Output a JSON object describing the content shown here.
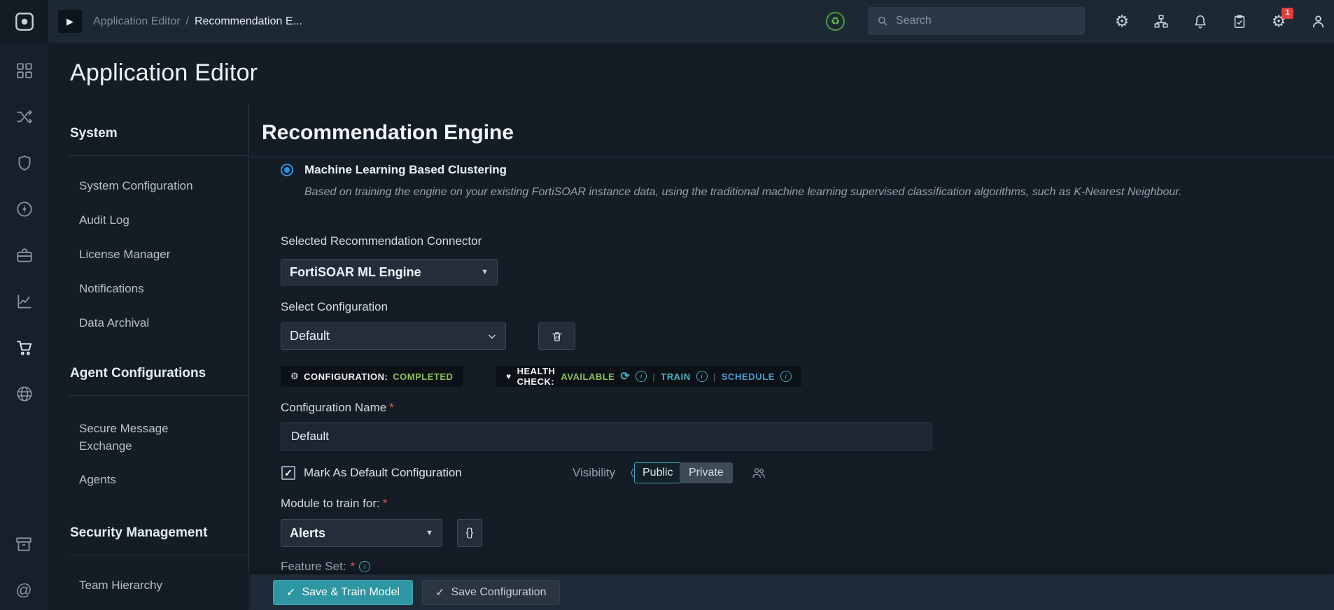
{
  "icons": {
    "play": "▶",
    "gear": "⚙",
    "recycle": "♻",
    "caret_down": "▼",
    "heart": "♥",
    "refresh": "⟳",
    "info": "i",
    "check": "✓",
    "braces": "{}",
    "at_sign": "@",
    "pipe": "|",
    "asterisk": "*"
  },
  "topbar": {
    "breadcrumb_parent": "Application Editor",
    "breadcrumb_sep": "/",
    "breadcrumb_current": "Recommendation E...",
    "search_placeholder": "Search",
    "badge_count": "1"
  },
  "page": {
    "title": "Application Editor"
  },
  "sidebar": {
    "sections": [
      {
        "title": "System",
        "items": [
          "System Configuration",
          "Audit Log",
          "License Manager",
          "Notifications",
          "Data Archival"
        ]
      },
      {
        "title": "Agent Configurations",
        "items": [
          "Secure Message Exchange",
          "Agents"
        ]
      },
      {
        "title": "Security Management",
        "items": [
          "Team Hierarchy"
        ]
      }
    ]
  },
  "main": {
    "title": "Recommendation Engine",
    "ml_option": {
      "label": "Machine Learning Based Clustering",
      "description": "Based on training the engine on your existing FortiSOAR instance data, using the traditional machine learning supervised classification algorithms, such as K-Nearest Neighbour."
    },
    "connector_label": "Selected Recommendation Connector",
    "connector_value": "FortiSOAR ML Engine",
    "config_select_label": "Select Configuration",
    "config_select_value": "Default",
    "status_chip": {
      "config_label": "CONFIGURATION:",
      "config_value": "COMPLETED",
      "health_label": "HEALTH CHECK:",
      "health_value": "AVAILABLE",
      "train": "TRAIN",
      "schedule": "SCHEDULE"
    },
    "config_name_label": "Configuration Name",
    "config_name_value": "Default",
    "mark_default_label": "Mark As Default Configuration",
    "visibility_label": "Visibility",
    "visibility_public": "Public",
    "visibility_private": "Private",
    "module_label": "Module to train for:",
    "module_value": "Alerts",
    "feature_set_label": "Feature Set:"
  },
  "footer": {
    "save_train": "Save & Train Model",
    "save_config": "Save Configuration"
  }
}
